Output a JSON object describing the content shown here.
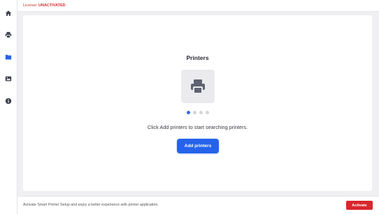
{
  "license": {
    "label": "License: ",
    "status": "UNACTIVATED"
  },
  "sidebar": {
    "items": [
      {
        "name": "home",
        "icon": "home-icon",
        "active": false
      },
      {
        "name": "printer",
        "icon": "printer-icon",
        "active": false
      },
      {
        "name": "folder",
        "icon": "folder-icon",
        "active": true
      },
      {
        "name": "image",
        "icon": "image-icon",
        "active": false
      },
      {
        "name": "info",
        "icon": "info-icon",
        "active": false
      }
    ]
  },
  "main": {
    "title": "Printers",
    "hint": "Click Add printers to start searching printers.",
    "add_button": "Add printers",
    "carousel": {
      "count": 4,
      "active_index": 0
    }
  },
  "footer": {
    "text": "Activate Smart Printer Setup and enjoy a better experience with printer application.",
    "activate_button": "Activate"
  },
  "colors": {
    "accent": "#2563eb",
    "danger": "#d9262c",
    "icon": "#3b3f4c",
    "background": "#f0f0f2"
  }
}
